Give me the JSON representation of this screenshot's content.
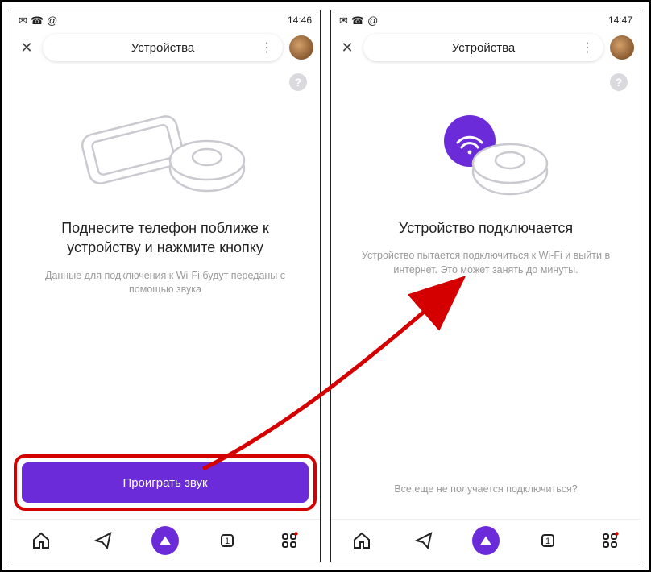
{
  "left": {
    "status_time": "14:46",
    "topbar_title": "Устройства",
    "heading": "Поднесите телефон поближе к устройству и нажмите кнопку",
    "subtext": "Данные для подключения к Wi-Fi будут переданы с помощью звука",
    "button": "Проиграть звук"
  },
  "right": {
    "status_time": "14:47",
    "topbar_title": "Устройства",
    "heading": "Устройство подключается",
    "subtext": "Устройство пытается подключиться к Wi-Fi и выйти в интернет. Это может занять до минуты.",
    "footer_link": "Все еще не получается подключиться?"
  },
  "icons": {
    "help": "?",
    "dots": "⋮"
  }
}
